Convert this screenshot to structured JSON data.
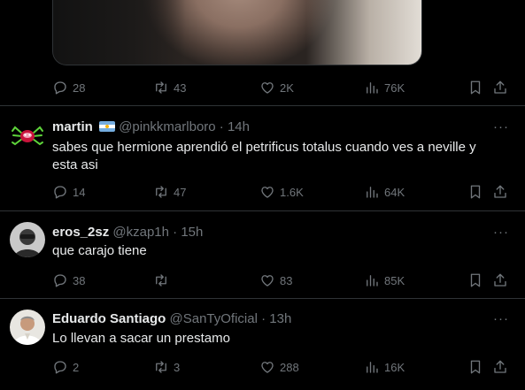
{
  "colors": {
    "background": "#000000",
    "text": "#e7e9ea",
    "muted": "#71767b",
    "divider": "#2f3336"
  },
  "icons": [
    "reply-icon",
    "retweet-icon",
    "like-icon",
    "views-icon",
    "bookmark-icon",
    "share-icon",
    "more-icon"
  ],
  "top_tweet": {
    "replies": "28",
    "retweets": "43",
    "likes": "2K",
    "views": "76K"
  },
  "tweets": [
    {
      "name": "martin",
      "flag": "argentina-flag",
      "handle": "@pinkkmarlboro",
      "sep": "·",
      "time": "14h",
      "text_line1": "sabes que hermione aprendió el petrificus totalus cuando ves a neville y",
      "text_line2": "esta asi",
      "replies": "14",
      "retweets": "47",
      "likes": "1.6K",
      "views": "64K"
    },
    {
      "name": "eros_2sz",
      "handle": "@kzap1h",
      "sep": "·",
      "time": "15h",
      "text_line1": "que carajo tiene",
      "replies": "38",
      "retweets": "",
      "likes": "83",
      "views": "85K"
    },
    {
      "name": "Eduardo Santiago",
      "handle": "@SanTyOficial",
      "sep": "·",
      "time": "13h",
      "text_line1": "Lo llevan a sacar un prestamo",
      "replies": "2",
      "retweets": "3",
      "likes": "288",
      "views": "16K"
    }
  ],
  "more_label": "···"
}
